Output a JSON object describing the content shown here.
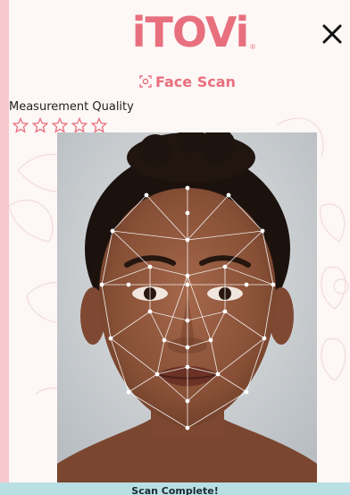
{
  "brand": {
    "logo_text": "iTOVi",
    "logo_mark": "®",
    "subtitle": "Face Scan",
    "subtitle_icon": "face-scan-icon",
    "color": "#e8707e"
  },
  "header": {
    "close_icon": "close-icon"
  },
  "quality": {
    "label": "Measurement Quality",
    "stars_total": 5,
    "stars_filled": 0,
    "star_color": "#e8707e"
  },
  "scan": {
    "image": "face-mesh-portrait",
    "status": "Scan Complete!",
    "status_bg": "#b9dfe4"
  },
  "colors": {
    "page_bg": "#f6c9cf",
    "card_bg": "#fdf7f6"
  }
}
